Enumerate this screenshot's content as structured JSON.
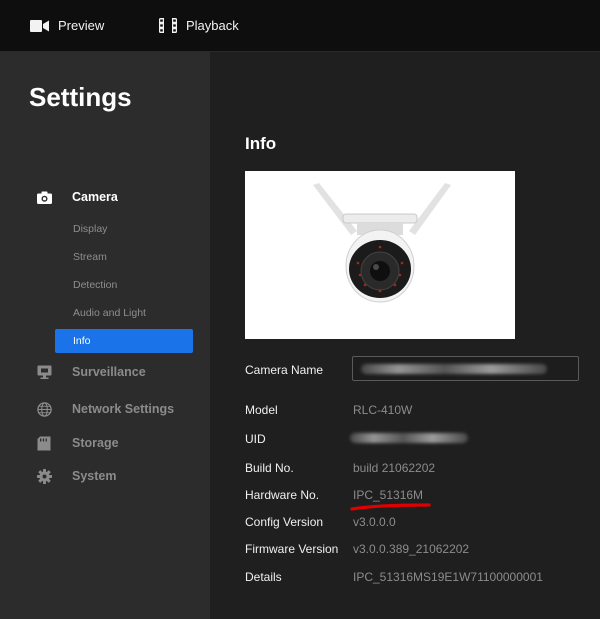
{
  "topnav": {
    "preview_label": "Preview",
    "playback_label": "Playback"
  },
  "sidebar": {
    "title": "Settings",
    "groups": [
      {
        "label": "Camera",
        "icon": "camera-icon"
      },
      {
        "label": "Surveillance",
        "icon": "monitor-icon"
      },
      {
        "label": "Network Settings",
        "icon": "globe-icon"
      },
      {
        "label": "Storage",
        "icon": "storage-icon"
      },
      {
        "label": "System",
        "icon": "gear-icon"
      }
    ],
    "camera_items": [
      "Display",
      "Stream",
      "Detection",
      "Audio and Light",
      "Info"
    ],
    "active_item": "Info"
  },
  "info": {
    "title": "Info",
    "rows": [
      {
        "label": "Camera Name",
        "value": ""
      },
      {
        "label": "Model",
        "value": "RLC-410W"
      },
      {
        "label": "UID",
        "value": ""
      },
      {
        "label": "Build No.",
        "value": "build 21062202"
      },
      {
        "label": "Hardware No.",
        "value": "IPC_51316M"
      },
      {
        "label": "Config Version",
        "value": "v3.0.0.0"
      },
      {
        "label": "Firmware Version",
        "value": "v3.0.0.389_21062202"
      },
      {
        "label": "Details",
        "value": "IPC_51316MS19E1W71100000001"
      }
    ]
  },
  "colors": {
    "accent": "#1a73e8",
    "annotation": "#e00000"
  }
}
